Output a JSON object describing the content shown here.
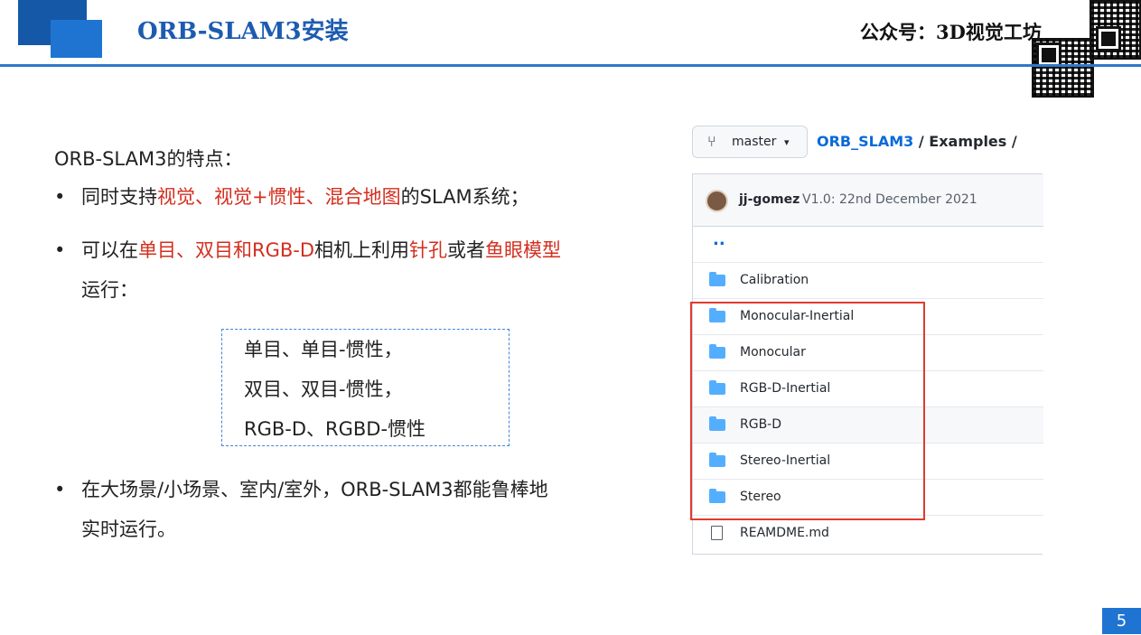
{
  "header": {
    "title": "ORB-SLAM3安装",
    "wechat": "公众号：3D视觉工坊"
  },
  "content": {
    "intro": "ORB-SLAM3的特点：",
    "bullet_char": "•",
    "b1": {
      "p1": "同时支持",
      "red": "视觉、视觉+惯性、混合地图",
      "p2": "的SLAM系统；"
    },
    "b2": {
      "p1": "可以在",
      "red1": "单目、双目和RGB-D",
      "p2": "相机上利用",
      "red2": "针孔",
      "p3": "或者",
      "red3": "鱼眼模型",
      "line2": "运行："
    },
    "modes": [
      "单目、单目-惯性，",
      "双目、双目-惯性，",
      "RGB-D、RGBD-惯性"
    ],
    "b3": {
      "line1": "在大场景/小场景、室内/室外，ORB-SLAM3都能鲁棒地",
      "line2": "实时运行。"
    }
  },
  "github": {
    "branch_icon": "⑂",
    "branch": "master",
    "caret": "▾",
    "repo": "ORB_SLAM3",
    "path": " / Examples /",
    "commit_author": "jj-gomez",
    "commit_msg": "V1.0: 22nd December 2021",
    "parent": "..",
    "folders": [
      "Calibration",
      "Monocular-Inertial",
      "Monocular",
      "RGB-D-Inertial",
      "RGB-D",
      "Stereo-Inertial",
      "Stereo"
    ],
    "file": "REAMDME.md"
  },
  "page_number": "5",
  "colors": {
    "accent": "#1f74d2",
    "highlight": "#d42e1e",
    "box": "#e03b2f"
  }
}
